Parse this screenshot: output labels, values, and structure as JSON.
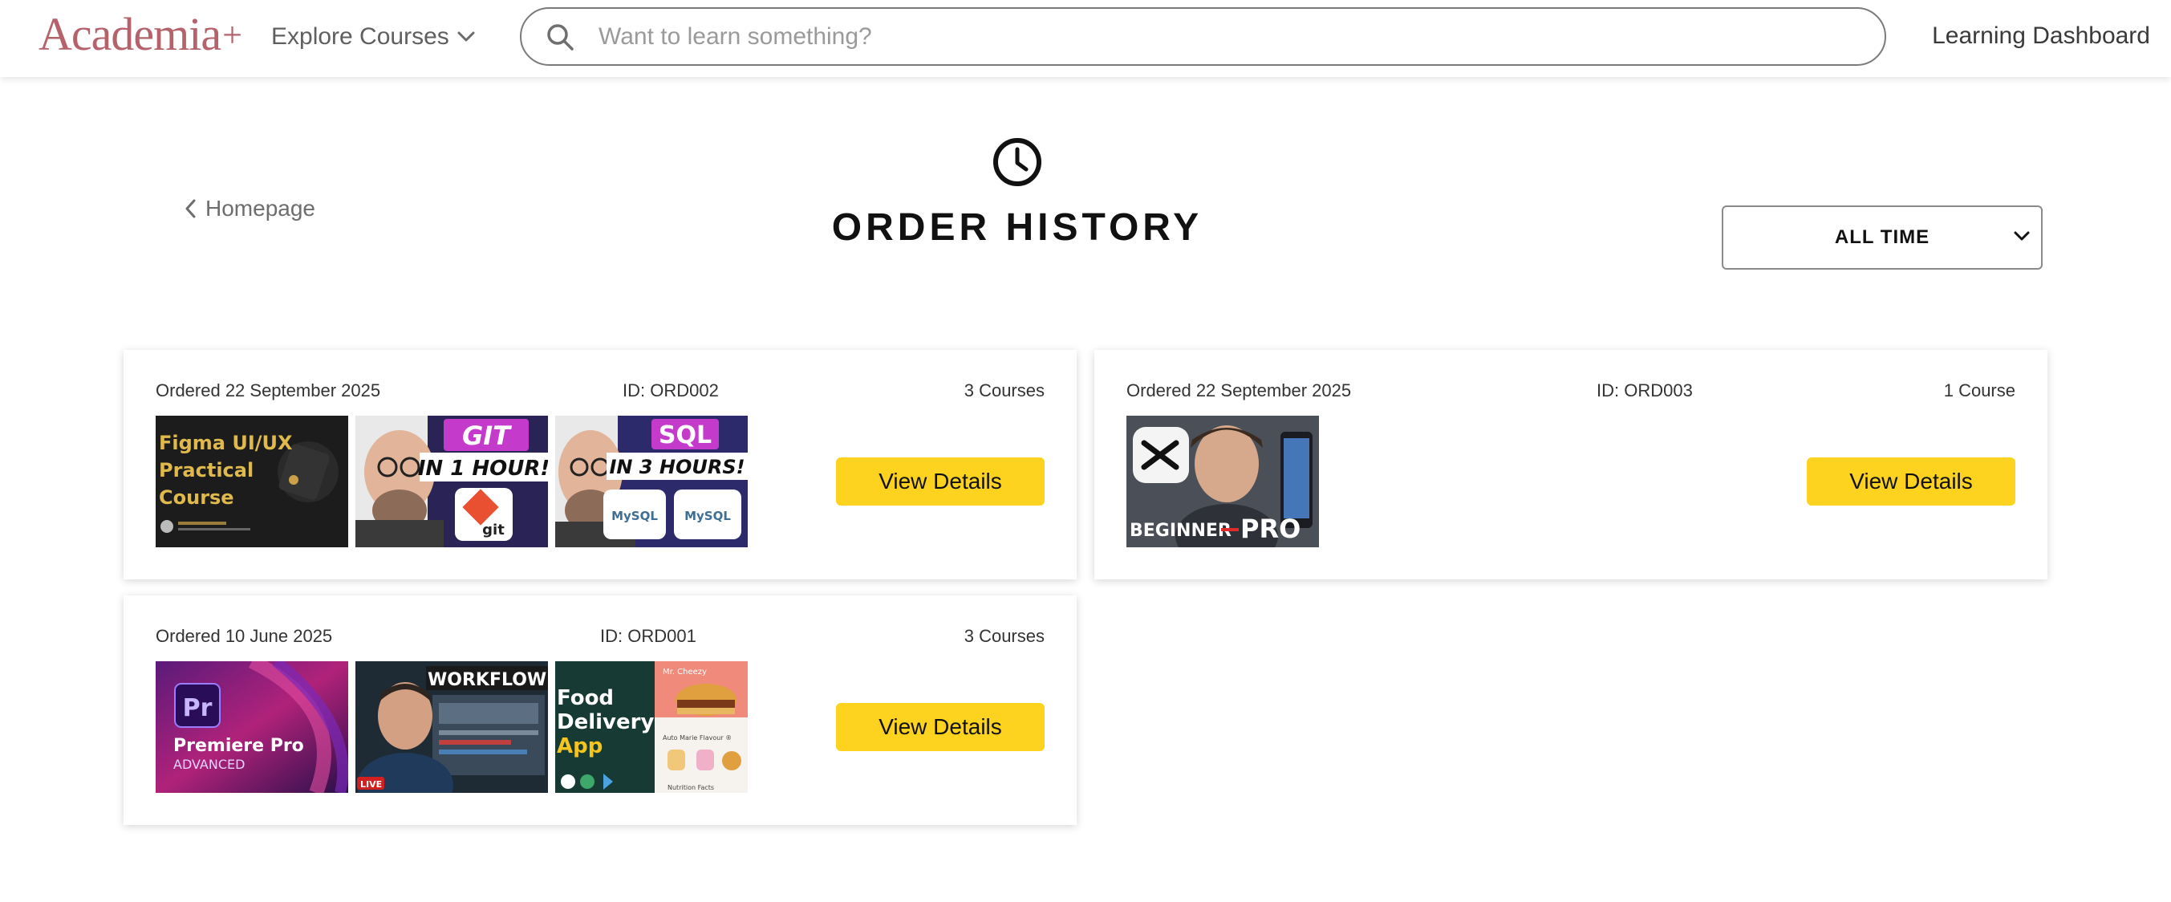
{
  "header": {
    "logo": "Academia",
    "logo_plus": "+",
    "explore_label": "Explore Courses",
    "search_placeholder": "Want to learn something?",
    "dashboard_label": "Learning Dashboard"
  },
  "page": {
    "title": "ORDER HISTORY",
    "back_label": "Homepage",
    "filter_value": "ALL TIME"
  },
  "orders": [
    {
      "date": "Ordered 22 September 2025",
      "id": "ID: ORD002",
      "count": "3 Courses",
      "button": "View Details",
      "thumbs": [
        {
          "lines": [
            "Figma UI/UX",
            "Practical",
            "Course"
          ]
        },
        {
          "top": "GIT",
          "mid": "IN 1 HOUR!",
          "badge": "git"
        },
        {
          "top": "SQL",
          "mid": "IN 3 HOURS!",
          "badge": "MySQL"
        }
      ]
    },
    {
      "date": "Ordered 22 September 2025",
      "id": "ID: ORD003",
      "count": "1 Course",
      "button": "View Details",
      "thumbs": [
        {
          "a": "BEGINNER",
          "b": "PRO"
        }
      ]
    },
    {
      "date": "Ordered 10 June 2025",
      "id": "ID: ORD001",
      "count": "3 Courses",
      "button": "View Details",
      "thumbs": [
        {
          "badge": "Pr",
          "line1": "Premiere Pro",
          "line2": "ADVANCED"
        },
        {
          "caption": "WORKFLOW H",
          "live": "LIVE"
        },
        {
          "lines": [
            "Food",
            "Delivery",
            "App"
          ],
          "tag": "Mr. Cheezy",
          "item1": "Auto Marie Flavour ®",
          "item2": "Nutrition Facts"
        }
      ]
    }
  ],
  "colors": {
    "brand": "#b5626b",
    "button": "#fdd320"
  }
}
